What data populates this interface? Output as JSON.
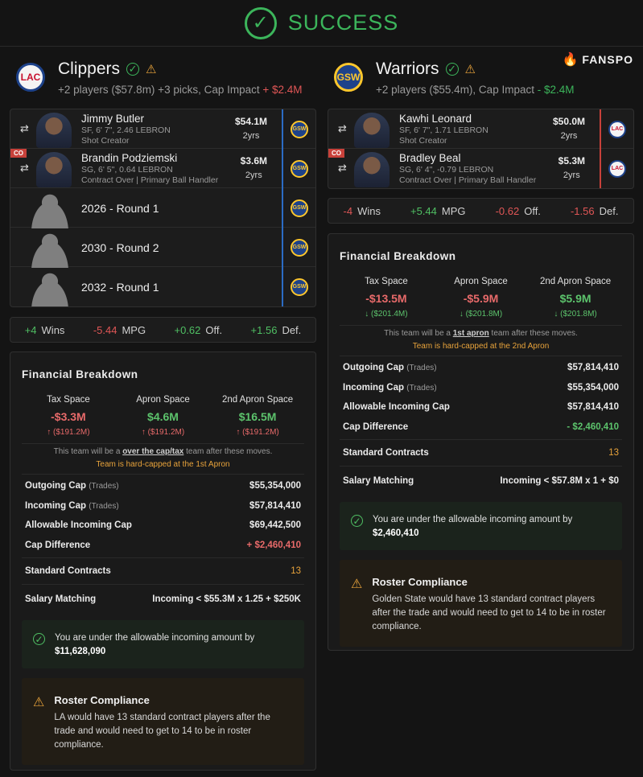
{
  "banner": {
    "status": "SUCCESS",
    "icon": "check-circle-icon"
  },
  "brand": {
    "name": "FANSPO",
    "icon": "flame-icon"
  },
  "left": {
    "team": "Clippers",
    "logo_text": "LAC",
    "summary_prefix": "+2 players ($57.8m) +3 picks, Cap Impact",
    "cap_impact": "+ $2.4M",
    "players": [
      {
        "name": "Jimmy Butler",
        "meta1": "SF, 6' 7\", 2.46 LEBRON",
        "meta2": "Shot Creator",
        "salary": "$54.1M",
        "years": "2yrs",
        "co": "",
        "dest": "GSW"
      },
      {
        "name": "Brandin Podziemski",
        "meta1": "SG, 6' 5\", 0.64 LEBRON",
        "meta2": "Contract Over | Primary Ball Handler",
        "salary": "$3.6M",
        "years": "2yrs",
        "co": "CO",
        "dest": "GSW"
      }
    ],
    "picks": [
      "2026 - Round 1",
      "2030 - Round 2",
      "2032 - Round 1"
    ],
    "stats": [
      {
        "value": "+4",
        "label": "Wins",
        "sign": "pos"
      },
      {
        "value": "-5.44",
        "label": "MPG",
        "sign": "neg"
      },
      {
        "value": "+0.62",
        "label": "Off.",
        "sign": "pos"
      },
      {
        "value": "+1.56",
        "label": "Def.",
        "sign": "pos"
      }
    ],
    "financial": {
      "title": "Financial Breakdown",
      "cols": [
        {
          "label": "Tax Space",
          "value": "-$3.3M",
          "sub": "↑ ($191.2M)",
          "tone": "red"
        },
        {
          "label": "Apron Space",
          "value": "$4.6M",
          "sub": "↑ ($191.2M)",
          "tone": "green"
        },
        {
          "label": "2nd Apron Space",
          "value": "$16.5M",
          "sub": "↑ ($191.2M)",
          "tone": "green"
        }
      ],
      "note_prefix": "This team will be a",
      "note_link": "over the cap/tax",
      "note_suffix": "team after these moves.",
      "hardcap": "Team is hard-capped at the 1st Apron",
      "lines": [
        {
          "label": "Outgoing Cap",
          "tag": "(Trades)",
          "value": "$55,354,000"
        },
        {
          "label": "Incoming Cap",
          "tag": "(Trades)",
          "value": "$57,814,410"
        },
        {
          "label": "Allowable Incoming Cap",
          "tag": "",
          "value": "$69,442,500"
        },
        {
          "label": "Cap Difference",
          "tag": "",
          "value": "+ $2,460,410"
        }
      ],
      "standard_label": "Standard Contracts",
      "standard_value": "13",
      "matching_label": "Salary Matching",
      "matching_value": "Incoming < $55.3M x 1.25 + $250K",
      "ok_text": "You are under the allowable incoming amount by",
      "ok_amount": "$11,628,090",
      "warn_title": "Roster Compliance",
      "warn_text": "LA would have 13 standard contract players after the trade and would need to get to 14 to be in roster compliance."
    }
  },
  "right": {
    "team": "Warriors",
    "logo_text": "GSW",
    "summary_prefix": "+2 players ($55.4m), Cap Impact",
    "cap_impact": "- $2.4M",
    "players": [
      {
        "name": "Kawhi Leonard",
        "meta1": "SF, 6' 7\", 1.71 LEBRON",
        "meta2": "Shot Creator",
        "salary": "$50.0M",
        "years": "2yrs",
        "co": "",
        "dest": "LAC"
      },
      {
        "name": "Bradley Beal",
        "meta1": "SG, 6' 4\", -0.79 LEBRON",
        "meta2": "Contract Over | Primary Ball Handler",
        "salary": "$5.3M",
        "years": "2yrs",
        "co": "CO",
        "dest": "LAC"
      }
    ],
    "stats": [
      {
        "value": "-4",
        "label": "Wins",
        "sign": "neg"
      },
      {
        "value": "+5.44",
        "label": "MPG",
        "sign": "pos"
      },
      {
        "value": "-0.62",
        "label": "Off.",
        "sign": "neg"
      },
      {
        "value": "-1.56",
        "label": "Def.",
        "sign": "neg"
      }
    ],
    "financial": {
      "title": "Financial Breakdown",
      "cols": [
        {
          "label": "Tax Space",
          "value": "-$13.5M",
          "sub": "↓ ($201.4M)",
          "tone": "red"
        },
        {
          "label": "Apron Space",
          "value": "-$5.9M",
          "sub": "↓ ($201.8M)",
          "tone": "red"
        },
        {
          "label": "2nd Apron Space",
          "value": "$5.9M",
          "sub": "↓ ($201.8M)",
          "tone": "green"
        }
      ],
      "note_prefix": "This team will be a",
      "note_link": "1st apron",
      "note_suffix": "team after these moves.",
      "hardcap": "Team is hard-capped at the 2nd Apron",
      "lines": [
        {
          "label": "Outgoing Cap",
          "tag": "(Trades)",
          "value": "$57,814,410"
        },
        {
          "label": "Incoming Cap",
          "tag": "(Trades)",
          "value": "$55,354,000"
        },
        {
          "label": "Allowable Incoming Cap",
          "tag": "",
          "value": "$57,814,410"
        },
        {
          "label": "Cap Difference",
          "tag": "",
          "value": "- $2,460,410"
        }
      ],
      "standard_label": "Standard Contracts",
      "standard_value": "13",
      "matching_label": "Salary Matching",
      "matching_value": "Incoming < $57.8M x 1 + $0",
      "ok_text": "You are under the allowable incoming amount by",
      "ok_amount": "$2,460,410",
      "warn_title": "Roster Compliance",
      "warn_text": "Golden State would have 13 standard contract players after the trade and would need to get to 14 to be in roster compliance."
    }
  }
}
